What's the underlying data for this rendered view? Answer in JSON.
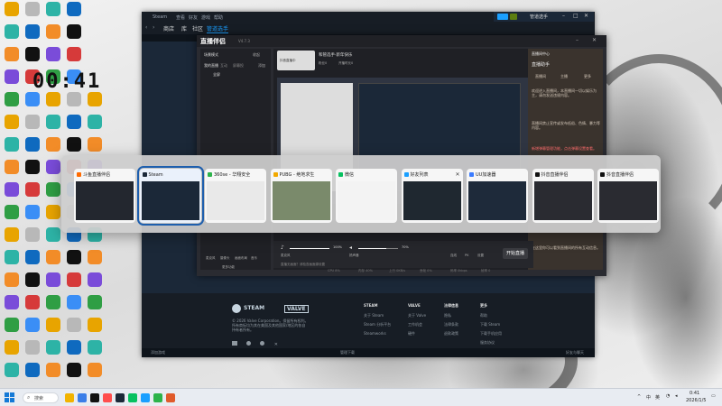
{
  "desktop": {
    "clock_wallpaper_text": "00:41",
    "icon_colors": [
      "#e8a400",
      "#3a8ef6",
      "#2f9e44",
      "#d63a3a",
      "#7a4cd9",
      "#111111",
      "#f28c28",
      "#0f6abf",
      "#2db3a6",
      "#b8b8b8"
    ]
  },
  "steam": {
    "title": "Steam",
    "menu": [
      "Steam",
      "查看",
      "好友",
      "游戏",
      "帮助"
    ],
    "nav": {
      "store": "商店",
      "library": "库",
      "community": "社区",
      "active_tab": "管道选手"
    },
    "user": "管道选手",
    "footer": {
      "steam_logo": "STEAM",
      "valve_logo": "VALVE",
      "copyright": "© 2026 Valve Corporation。保留所有权利。所有商标均为其在美国及其他国家/地区的各自持有者所有。",
      "col1_head": "STEAM",
      "col1": [
        "关于 Steam",
        "Steam 分析平台",
        "Steamworks"
      ],
      "col2_head": "VALVE",
      "col2": [
        "关于 Valve",
        "工作机会",
        "硬件"
      ],
      "col3_head": "法律信息",
      "col3": [
        "隐私",
        "法律条款",
        "退款政策"
      ],
      "col4_head": "更多",
      "col4": [
        "帮助",
        "下载 Steam",
        "下载手机应用",
        "服务协议"
      ]
    },
    "status": {
      "add_game": "添加游戏",
      "manage_downloads": "管理下载",
      "friends_chat": "好友与聊天"
    }
  },
  "live_window": {
    "logo": "直播伴侣",
    "version": "V4.7.3",
    "scene_label": "场景模式",
    "collapse_label": "收起",
    "add_label": "添加",
    "tabs": [
      "我的直播",
      "互动",
      "屏幕投"
    ],
    "scene_item": "全屏",
    "user_tag": "抖音直播中",
    "user_name": "和管选手·新年快乐",
    "stats": [
      "粉丝0",
      "开播时长0"
    ],
    "right_header": "直播间中心",
    "right_title": "直播助手",
    "right_tabs": [
      "直播间",
      "主播",
      "更多"
    ],
    "right_notes": [
      "欢迎进入直播间，本直播间一切以娱乐为主，请勿发送违规内容。",
      "直播间禁止宣传或发布低俗、色情、暴力等内容。",
      "新增弹幕管理功能，点击弹幕设置查看。",
      "在这里你可以看到直播间的所有互动信息。"
    ],
    "tools": [
      "麦克风",
      "摄像头",
      "画面布局",
      "音乐",
      "下播设置"
    ],
    "mic_label": "麦克风",
    "mic_value": "100%",
    "speaker_label": "扬声器",
    "speaker_value": "70%",
    "mic_level": 1.0,
    "speaker_level": 0.7,
    "bottom_tools": [
      "连线",
      "PK",
      "设置"
    ],
    "start_live": "开始直播",
    "more_features": "更多功能",
    "hint": "直播无画面？请检查画面源设置",
    "stats_bar": [
      "CPU 8%",
      "内存 40%",
      "上行 0KB/s",
      "丢帧 0%",
      "码率 0kbps",
      "帧率 0"
    ]
  },
  "switcher": {
    "cards": [
      {
        "title": "斗鱼直播伴侣",
        "icon_color": "#ff6a00",
        "thumb_color": "#23272f",
        "selected": false
      },
      {
        "title": "Steam",
        "icon_color": "#1b2838",
        "thumb_color": "#1b2838",
        "selected": true
      },
      {
        "title": "360se - 华翔安全",
        "icon_color": "#2db34a",
        "thumb_color": "#e9e9e9",
        "selected": false
      },
      {
        "title": "PUBG - 绝地求生",
        "icon_color": "#f2a900",
        "thumb_color": "#7a8a6b",
        "selected": false
      },
      {
        "title": "微信",
        "icon_color": "#07c160",
        "thumb_color": "#f3f3f3",
        "selected": false
      },
      {
        "title": "好友列表",
        "icon_color": "#1a9fff",
        "thumb_color": "#1f2830",
        "selected": false,
        "closable": true
      },
      {
        "title": "UU加速器",
        "icon_color": "#3a7bff",
        "thumb_color": "#1e2a3a",
        "selected": false
      },
      {
        "title": "抖音直播伴侣",
        "icon_color": "#111111",
        "thumb_color": "#2a2b31",
        "selected": false
      },
      {
        "title": "抖音直播伴侣",
        "icon_color": "#111111",
        "thumb_color": "#2a2b31",
        "selected": false
      }
    ]
  },
  "taskbar": {
    "search_placeholder": "搜索",
    "app_colors": [
      "#f2b300",
      "#3b7ee8",
      "#111111",
      "#ff4e4e",
      "#1b2838",
      "#07c160",
      "#1a9fff",
      "#2db34a",
      "#e05b2b"
    ],
    "tray_lang": "中",
    "tray_lang2": "英",
    "time": "0:41",
    "date": "2026/1/5"
  }
}
